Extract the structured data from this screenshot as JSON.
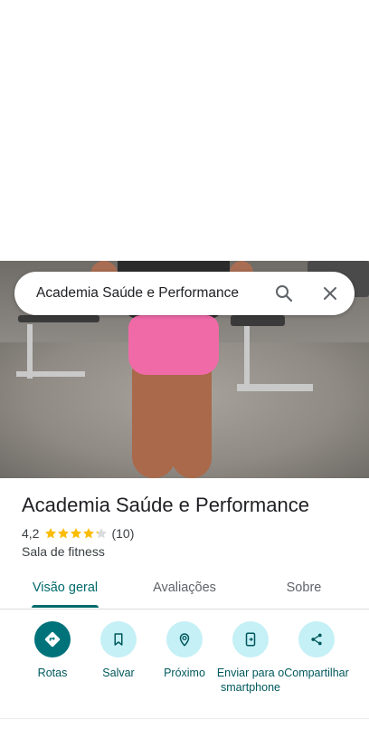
{
  "search": {
    "query": "Academia Saúde e Performance"
  },
  "place": {
    "name": "Academia Saúde e Performance",
    "rating": "4,2",
    "rating_value": 4.2,
    "review_count": "(10)",
    "category": "Sala de fitness"
  },
  "tabs": [
    {
      "label": "Visão geral",
      "active": true
    },
    {
      "label": "Avaliações",
      "active": false
    },
    {
      "label": "Sobre",
      "active": false
    }
  ],
  "actions": [
    {
      "label": "Rotas",
      "icon": "directions-icon"
    },
    {
      "label": "Salvar",
      "icon": "bookmark-icon"
    },
    {
      "label": "Próximo",
      "icon": "nearby-icon"
    },
    {
      "label": "Enviar para o smartphone",
      "icon": "send-to-phone-icon"
    },
    {
      "label": "Compartilhar",
      "icon": "share-icon"
    }
  ],
  "colors": {
    "accent": "#00727a",
    "accent_light": "#c4f0f6",
    "star": "#fbbc04"
  }
}
